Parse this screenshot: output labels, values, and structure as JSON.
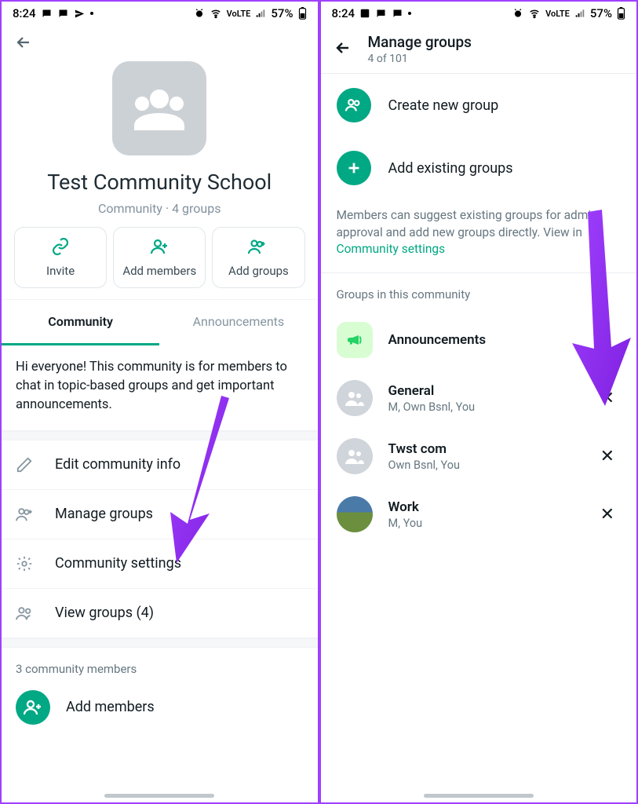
{
  "statusbar": {
    "time": "8:24",
    "battery": "57%",
    "network_label": "VoLTE"
  },
  "screen1": {
    "title": "Test Community School",
    "subtitle": "Community · 4 groups",
    "actions": {
      "invite": "Invite",
      "add_members": "Add members",
      "add_groups": "Add groups"
    },
    "tabs": {
      "community": "Community",
      "announcements": "Announcements"
    },
    "description": "Hi everyone! This community is for members to chat in topic-based groups and get important announcements.",
    "options": {
      "edit": "Edit community info",
      "manage": "Manage groups",
      "settings": "Community settings",
      "view": "View groups (4)"
    },
    "members_header": "3 community members",
    "add_members_label": "Add members"
  },
  "screen2": {
    "title": "Manage groups",
    "subtitle": "4 of 101",
    "create": "Create new group",
    "add_existing": "Add existing groups",
    "info_prefix": "Members can suggest existing groups for admin approval and add new groups directly. View in ",
    "info_link": "Community settings",
    "section_label": "Groups in this community",
    "groups": [
      {
        "name": "Announcements",
        "sub": "",
        "removable": false
      },
      {
        "name": "General",
        "sub": "M, Own Bsnl, You",
        "removable": true
      },
      {
        "name": "Twst com",
        "sub": "Own Bsnl, You",
        "removable": true
      },
      {
        "name": "Work",
        "sub": "M, You",
        "removable": true
      }
    ]
  }
}
